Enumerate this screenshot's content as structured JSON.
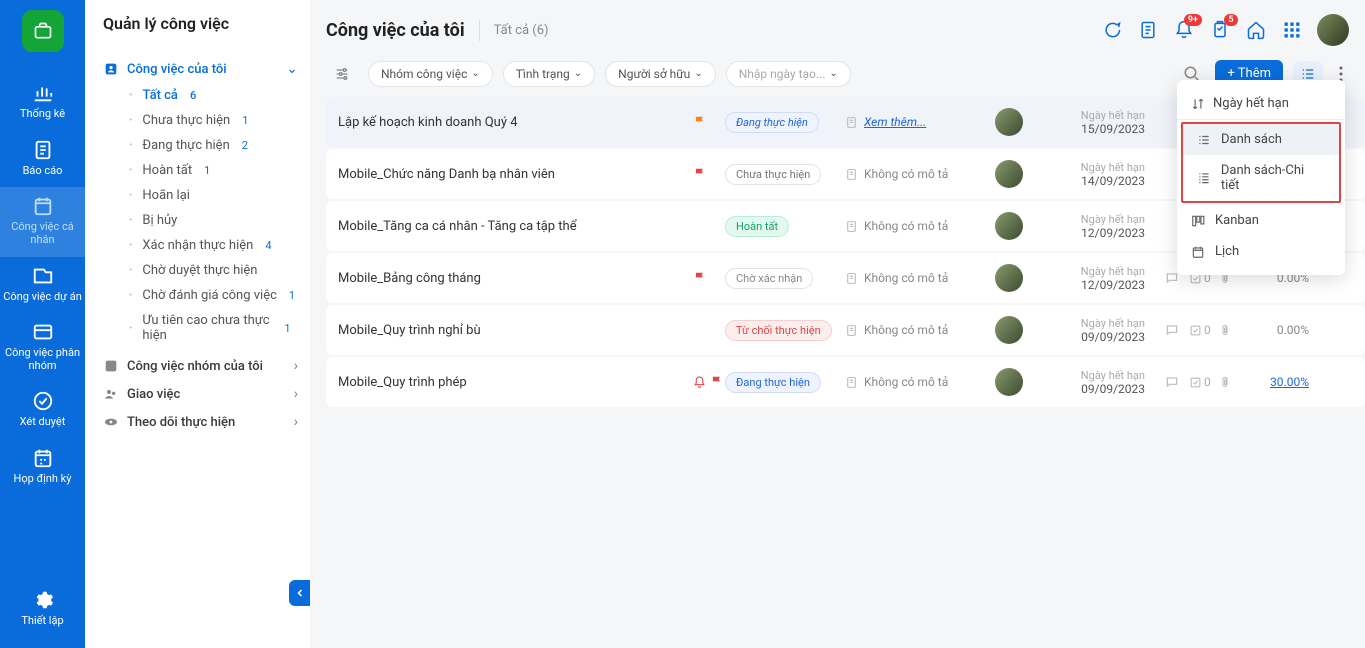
{
  "rail": {
    "items": [
      {
        "label": "Thống kê"
      },
      {
        "label": "Báo cáo"
      },
      {
        "label": "Công việc cá nhân"
      },
      {
        "label": "Công việc dự án"
      },
      {
        "label": "Công việc phân nhóm"
      },
      {
        "label": "Xét duyệt"
      },
      {
        "label": "Họp định kỳ"
      }
    ],
    "settings_label": "Thiết lập"
  },
  "sidebar": {
    "title": "Quản lý công việc",
    "my_tasks_label": "Công việc của tôi",
    "filters": [
      {
        "label": "Tất cả",
        "count": "6"
      },
      {
        "label": "Chưa thực hiện",
        "count": "1"
      },
      {
        "label": "Đang thực hiện",
        "count": "2"
      },
      {
        "label": "Hoàn tất",
        "count": "1"
      },
      {
        "label": "Hoãn lại",
        "count": ""
      },
      {
        "label": "Bị hủy",
        "count": ""
      },
      {
        "label": "Xác nhận thực hiện",
        "count": "4"
      },
      {
        "label": "Chờ duyệt thực hiện",
        "count": ""
      },
      {
        "label": "Chờ đánh giá công việc",
        "count": "1"
      },
      {
        "label": "Ưu tiên cao chưa thực hiện",
        "count": "1"
      }
    ],
    "groups": [
      {
        "label": "Công việc nhóm của tôi"
      },
      {
        "label": "Giao việc"
      },
      {
        "label": "Theo dõi thực hiện"
      }
    ]
  },
  "header": {
    "title": "Công việc của tôi",
    "subtitle": "Tất cả (6)",
    "notif_bell": "9+",
    "notif_clip": "5"
  },
  "filters": {
    "settings_tooltip": "Cài đặt",
    "group": "Nhóm công việc",
    "status": "Tình trạng",
    "owner": "Người sở hữu",
    "date_placeholder": "Nhập ngày tạo...",
    "add_label": "+ Thêm"
  },
  "rows": [
    {
      "title": "Lập kế hoạch kinh doanh Quý 4",
      "flag": "orange",
      "status": "Đang thực hiện",
      "status_cls": "sp-blue",
      "desc": "Xem thêm...",
      "desc_link": true,
      "due_label": "Ngày hết hạn",
      "due": "15/09/2023",
      "pct": ""
    },
    {
      "title": "Mobile_Chức năng Danh bạ nhân viên",
      "flag": "red",
      "status": "Chưa thực hiện",
      "status_cls": "sp-gray",
      "desc": "Không có mô tả",
      "desc_link": false,
      "due_label": "Ngày hết hạn",
      "due": "14/09/2023",
      "pct": ""
    },
    {
      "title": "Mobile_Tăng ca cá nhân - Tăng ca tập thể",
      "flag": "",
      "status": "Hoàn tất",
      "status_cls": "sp-green",
      "desc": "Không có mô tả",
      "desc_link": false,
      "due_label": "Ngày hết hạn",
      "due": "12/09/2023",
      "pct": "%"
    },
    {
      "title": "Mobile_Bảng công tháng",
      "flag": "red",
      "status": "Chờ xác nhận",
      "status_cls": "sp-wait",
      "desc": "Không có mô tả",
      "desc_link": false,
      "due_label": "Ngày hết hạn",
      "due": "12/09/2023",
      "stats": "0",
      "pct": "0.00%"
    },
    {
      "title": "Mobile_Quy trình nghỉ bù",
      "flag": "",
      "status": "Từ chối thực hiện",
      "status_cls": "sp-red",
      "desc": "Không có mô tả",
      "desc_link": false,
      "due_label": "Ngày hết hạn",
      "due": "09/09/2023",
      "stats": "0",
      "pct": "0.00%"
    },
    {
      "title": "Mobile_Quy trình phép",
      "flag": "red",
      "bell": true,
      "status": "Đang thực hiện",
      "status_cls": "sp-blue2",
      "desc": "Không có mô tả",
      "desc_link": false,
      "due_label": "Ngày hết hạn",
      "due": "09/09/2023",
      "stats": "0",
      "pct": "30.00%",
      "pct_link": true
    }
  ],
  "dropdown": {
    "sort_label": "Ngày hết hạn",
    "items": [
      {
        "label": "Danh sách",
        "active": true
      },
      {
        "label": "Danh sách-Chi tiết"
      },
      {
        "label": "Kanban"
      },
      {
        "label": "Lịch"
      }
    ]
  }
}
